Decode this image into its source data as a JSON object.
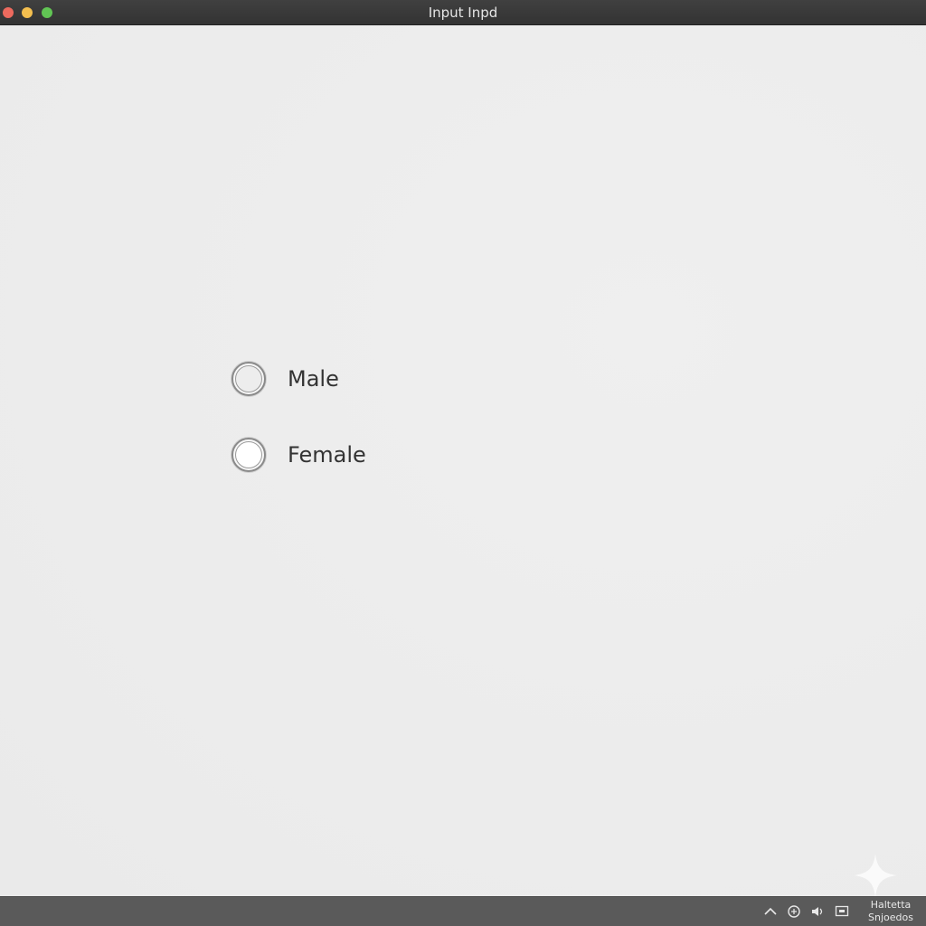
{
  "window": {
    "title": "Input Inpd"
  },
  "colors": {
    "close": "#ed6a5e",
    "minimize": "#f4bf4f",
    "zoom": "#61c554"
  },
  "radio_group": {
    "options": [
      {
        "label": "Male",
        "selected": false
      },
      {
        "label": "Female",
        "selected": false
      }
    ]
  },
  "taskbar": {
    "icons": [
      "chevron-up-icon",
      "network-icon",
      "volume-icon",
      "display-icon"
    ],
    "clock": {
      "line1": "Haltetta",
      "line2": "Snjoedos"
    }
  }
}
